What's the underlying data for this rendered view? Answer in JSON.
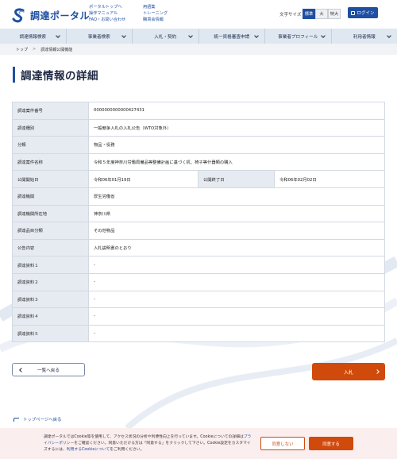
{
  "header": {
    "logo_text": "調達ポータル",
    "links_col1": [
      "ポータルトップへ",
      "操作マニュアル",
      "FAQ・お問い合わせ"
    ],
    "links_col2": [
      "用語集",
      "トレーニング",
      "購買会情報"
    ],
    "font_size_label": "文字サイズ",
    "font_sizes": [
      "標準",
      "大",
      "特大"
    ],
    "login_label": "ログイン"
  },
  "nav": {
    "items": [
      "調達情報検索",
      "事業者検索",
      "入札・契約",
      "統一資格審査申請",
      "事業者プロフィール",
      "利用者情報"
    ]
  },
  "breadcrumb": {
    "home": "トップ",
    "current": "調達情報公開機能"
  },
  "page": {
    "title": "調達情報の詳細"
  },
  "detail": {
    "rows": [
      {
        "label": "調達案件番号",
        "value": "0000000000000427431"
      },
      {
        "label": "調達種別",
        "value": "一般競争入札の入札公告（WTO対象外）"
      },
      {
        "label": "分類",
        "value": "物品・役務"
      },
      {
        "label": "調達案件名称",
        "value": "令和５年度神奈川労働局備品等整備計画に基づく机、椅子等什器類の購入"
      },
      {
        "label": "公開開始日",
        "value": "令和06年01月19日",
        "label2": "公開終了日",
        "value2": "令和06年02月02日"
      },
      {
        "label": "調達機関",
        "value": "厚生労働省"
      },
      {
        "label": "調達機関所在地",
        "value": "神奈川県"
      },
      {
        "label": "調達品目分類",
        "value": "その他物品"
      },
      {
        "label": "公告内容",
        "value": "入札説明書のとおり"
      },
      {
        "label": "調達資料１",
        "value": "-"
      },
      {
        "label": "調達資料２",
        "value": "-"
      },
      {
        "label": "調達資料３",
        "value": "-"
      },
      {
        "label": "調達資料４",
        "value": "-"
      },
      {
        "label": "調達資料５",
        "value": "-"
      }
    ]
  },
  "actions": {
    "back_label": "一覧へ戻る",
    "bid_label": "入札"
  },
  "footer": {
    "to_top_label": "トップページへ戻る"
  },
  "cookie": {
    "text_before_link": "調達ポータルではCookie等を使用して、アクセス状況の分析や利便性向上を行っています。Cookieについての詳細は",
    "privacy_link": "プライバシーポリシー",
    "text_middle": "をご確認ください。同意いただける方は「同意する」をクリックして下さい。Cookie設定をカスタマイズするには、",
    "cookie_link": "利用するCookieについて",
    "text_after": "をご利用ください。",
    "deny_label": "同意しない",
    "accept_label": "同意する"
  },
  "colors": {
    "primary": "#1f4fa0",
    "accent": "#d04a0c",
    "table_header_bg": "#e6ebf2",
    "cookie_bg": "#fbeeee"
  }
}
